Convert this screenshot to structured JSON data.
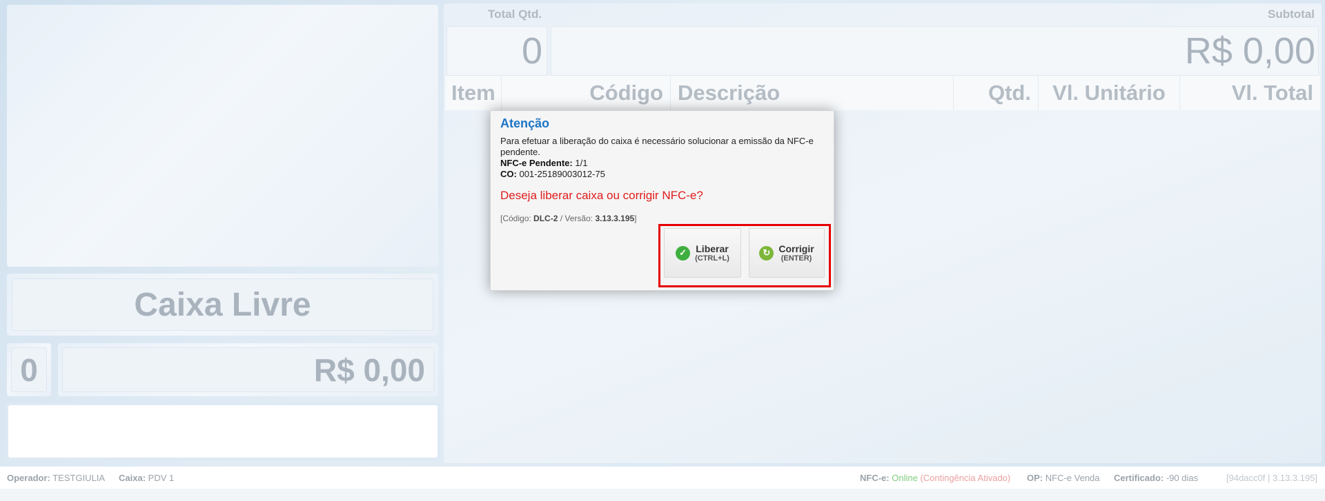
{
  "left": {
    "status": "Caixa Livre",
    "count": "0",
    "total": "R$ 0,00"
  },
  "header": {
    "total_qtd_label": "Total Qtd.",
    "total_qtd_value": "0",
    "subtotal_label": "Subtotal",
    "subtotal_value": "R$ 0,00"
  },
  "table": {
    "columns": [
      "Item",
      "Código",
      "Descrição",
      "Qtd.",
      "Vl. Unitário",
      "Vl. Total"
    ]
  },
  "dialog": {
    "title": "Atenção",
    "message": "Para efetuar a liberação do caixa é necessário solucionar a emissão da NFC-e pendente.",
    "pendente_label": "NFC-e Pendente:",
    "pendente_value": "1/1",
    "co_label": "CO:",
    "co_value": "001-25189003012-75",
    "question": "Deseja liberar caixa ou corrigir NFC-e?",
    "meta_prefix": "[Código:",
    "meta_code": "DLC-2",
    "meta_version_label": "/ Versão:",
    "meta_version": "3.13.3.195",
    "meta_suffix": "]",
    "buttons": [
      {
        "label": "Liberar",
        "shortcut": "(CTRL+L)",
        "icon": "check-icon"
      },
      {
        "label": "Corrigir",
        "shortcut": "(ENTER)",
        "icon": "refresh-icon"
      }
    ],
    "highlight_color": "#e60000"
  },
  "status_bar": {
    "operador_label": "Operador:",
    "operador_value": "TESTGIULIA",
    "caixa_label": "Caixa:",
    "caixa_value": "PDV 1",
    "nfce_label": "NFC-e:",
    "nfce_status": "Online",
    "nfce_contingencia": "(Contingência Ativado)",
    "op_label": "OP:",
    "op_value": "NFC-e Venda",
    "cert_label": "Certificado:",
    "cert_value": "-90 dias",
    "version": "[94dacc0f | 3.13.3.195]"
  }
}
